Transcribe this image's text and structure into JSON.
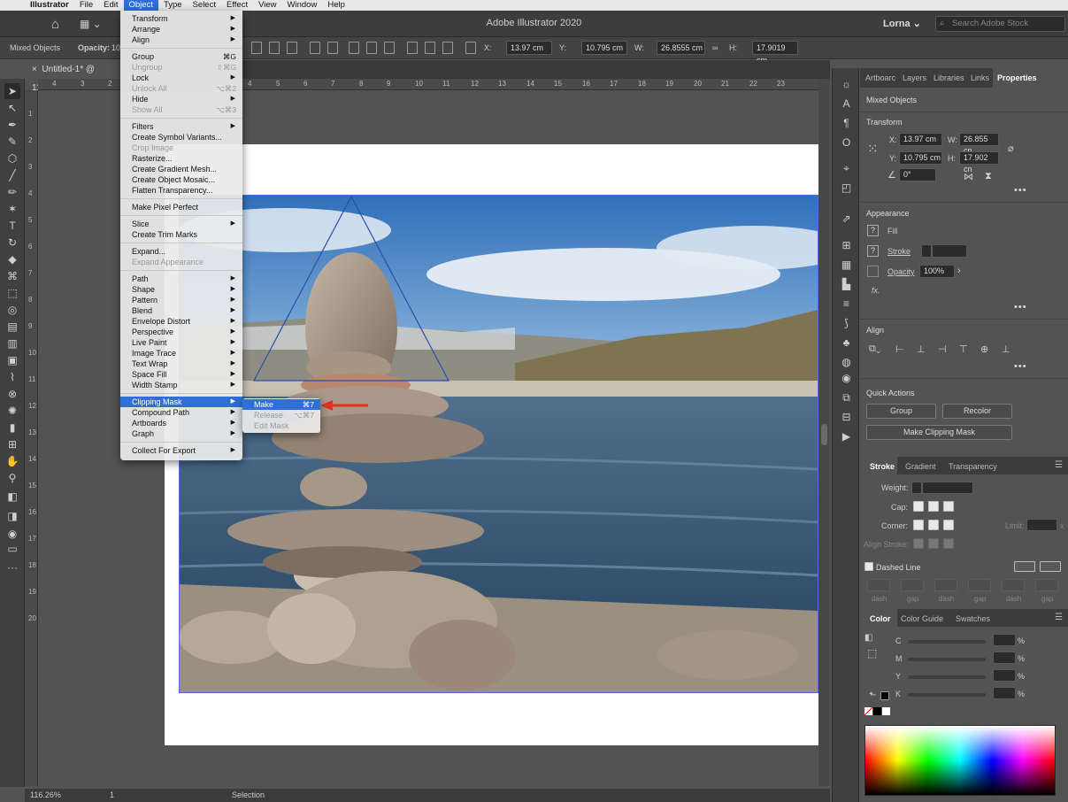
{
  "menubar": {
    "app": "Illustrator",
    "items": [
      "File",
      "Edit",
      "Object",
      "Type",
      "Select",
      "Effect",
      "View",
      "Window",
      "Help"
    ],
    "active": "Object"
  },
  "appbar": {
    "title": "Adobe Illustrator 2020",
    "user": "Lorna",
    "search_placeholder": "Search Adobe Stock"
  },
  "controlbar": {
    "selection_label": "Mixed Objects",
    "opacity_label": "Opacity:",
    "opacity_value": "10",
    "x_label": "X:",
    "x_value": "13.97 cm",
    "y_label": "Y:",
    "y_value": "10.795 cm",
    "w_label": "W:",
    "w_value": "26.8555 cm",
    "h_label": "H:",
    "h_value": "17.9019 cm"
  },
  "document": {
    "tab_title": "Untitled-1* @ 116.26",
    "ruler_marks": [
      "4",
      "3",
      "2",
      "1",
      "0",
      "1",
      "2",
      "3",
      "4",
      "5",
      "6",
      "7",
      "8",
      "9",
      "10",
      "11",
      "12",
      "13",
      "14",
      "15",
      "16",
      "17",
      "18",
      "19",
      "20",
      "21",
      "22",
      "23"
    ],
    "vruler_marks": [
      "1",
      "2",
      "3",
      "4",
      "5",
      "6",
      "7",
      "8",
      "9",
      "10",
      "11",
      "12",
      "13",
      "14",
      "15",
      "16",
      "17",
      "18",
      "19",
      "20"
    ]
  },
  "statusbar": {
    "zoom": "116.26%",
    "page": "1",
    "mode": "Selection"
  },
  "object_menu": {
    "groups": [
      [
        {
          "label": "Transform",
          "arrow": true
        },
        {
          "label": "Arrange",
          "arrow": true
        },
        {
          "label": "Align",
          "arrow": true
        }
      ],
      [
        {
          "label": "Group",
          "shortcut": "⌘G"
        },
        {
          "label": "Ungroup",
          "shortcut": "⇧⌘G",
          "disabled": true
        },
        {
          "label": "Lock",
          "arrow": true
        },
        {
          "label": "Unlock All",
          "shortcut": "⌥⌘2",
          "disabled": true
        },
        {
          "label": "Hide",
          "arrow": true
        },
        {
          "label": "Show All",
          "shortcut": "⌥⌘3",
          "disabled": true
        }
      ],
      [
        {
          "label": "Filters",
          "arrow": true
        },
        {
          "label": "Create Symbol Variants..."
        },
        {
          "label": "Crop Image",
          "disabled": true
        },
        {
          "label": "Rasterize..."
        },
        {
          "label": "Create Gradient Mesh..."
        },
        {
          "label": "Create Object Mosaic..."
        },
        {
          "label": "Flatten Transparency..."
        }
      ],
      [
        {
          "label": "Make Pixel Perfect"
        }
      ],
      [
        {
          "label": "Slice",
          "arrow": true
        },
        {
          "label": "Create Trim Marks"
        }
      ],
      [
        {
          "label": "Expand..."
        },
        {
          "label": "Expand Appearance",
          "disabled": true
        }
      ],
      [
        {
          "label": "Path",
          "arrow": true
        },
        {
          "label": "Shape",
          "arrow": true
        },
        {
          "label": "Pattern",
          "arrow": true
        },
        {
          "label": "Blend",
          "arrow": true
        },
        {
          "label": "Envelope Distort",
          "arrow": true
        },
        {
          "label": "Perspective",
          "arrow": true
        },
        {
          "label": "Live Paint",
          "arrow": true
        },
        {
          "label": "Image Trace",
          "arrow": true
        },
        {
          "label": "Text Wrap",
          "arrow": true
        },
        {
          "label": "Space Fill",
          "arrow": true
        },
        {
          "label": "Width Stamp",
          "arrow": true
        }
      ],
      [
        {
          "label": "Clipping Mask",
          "arrow": true,
          "highlighted": true
        },
        {
          "label": "Compound Path",
          "arrow": true
        },
        {
          "label": "Artboards",
          "arrow": true
        },
        {
          "label": "Graph",
          "arrow": true
        }
      ],
      [
        {
          "label": "Collect For Export",
          "arrow": true
        }
      ]
    ]
  },
  "clipping_submenu": [
    {
      "label": "Make",
      "shortcut": "⌘7",
      "highlighted": true
    },
    {
      "label": "Release",
      "shortcut": "⌥⌘7",
      "disabled": true
    },
    {
      "label": "Edit Mask",
      "disabled": true
    }
  ],
  "properties": {
    "tabs": [
      "Artboarc",
      "Layers",
      "Libraries",
      "Links",
      "Properties"
    ],
    "selection": "Mixed Objects",
    "transform": {
      "heading": "Transform",
      "x_label": "X:",
      "x": "13.97 cm",
      "y_label": "Y:",
      "y": "10.795 cm",
      "w_label": "W:",
      "w": "26.855 cn",
      "h_label": "H:",
      "h": "17.902 cn",
      "rotate": "0°"
    },
    "appearance": {
      "heading": "Appearance",
      "fill": "Fill",
      "stroke": "Stroke",
      "opacity_label": "Opacity",
      "opacity": "100%",
      "fx": "fx."
    },
    "align_heading": "Align",
    "quick_actions": {
      "heading": "Quick Actions",
      "group": "Group",
      "recolor": "Recolor",
      "make_clipping_mask": "Make Clipping Mask"
    }
  },
  "stroke_panel": {
    "tabs": [
      "Stroke",
      "Gradient",
      "Transparency"
    ],
    "weight": "Weight:",
    "cap": "Cap:",
    "corner": "Corner:",
    "limit": "Limit:",
    "limit_unit": "x",
    "align_stroke": "Align Stroke:",
    "dashed_line": "Dashed Line",
    "dash_labels": [
      "dash",
      "gap",
      "dash",
      "gap",
      "dash",
      "gap"
    ]
  },
  "color_panel": {
    "tabs": [
      "Color",
      "Color Guide",
      "Swatches"
    ],
    "channels": [
      "C",
      "M",
      "Y",
      "K"
    ],
    "unit": "%"
  }
}
